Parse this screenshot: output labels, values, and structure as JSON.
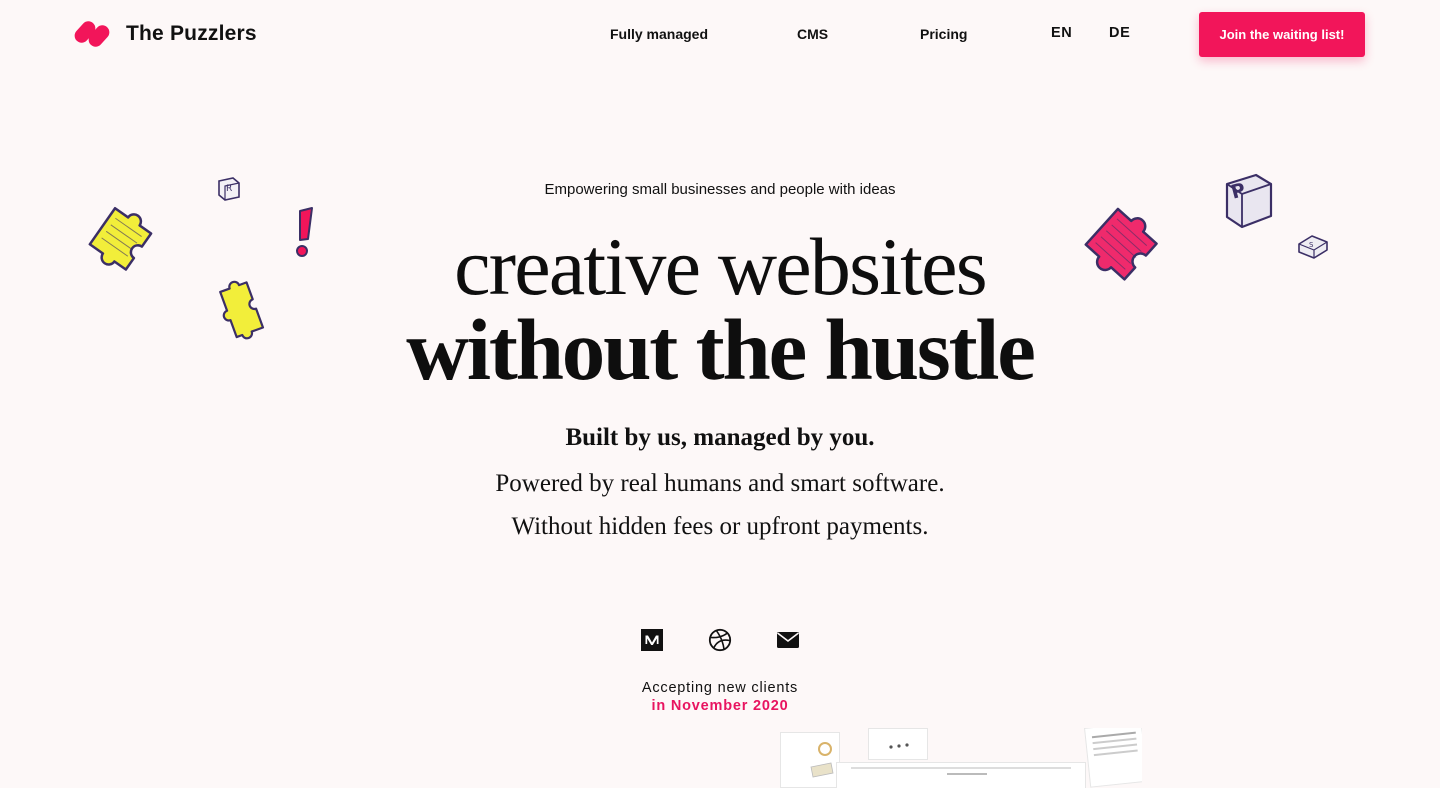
{
  "header": {
    "brand": "The Puzzlers",
    "nav": [
      {
        "label": "Fully managed"
      },
      {
        "label": "CMS"
      },
      {
        "label": "Pricing"
      }
    ],
    "languages": {
      "en": "EN",
      "de": "DE",
      "active": "EN"
    },
    "cta_label": "Join the waiting list!"
  },
  "hero": {
    "tagline": "Empowering small businesses and people with ideas",
    "headline_line1": "creative websites",
    "headline_line2": "without the hustle",
    "subhead_highlight": "Built by us, managed by you.",
    "subhead_line2": "Powered by real humans and smart software.",
    "subhead_line3": "Without hidden fees or upfront payments."
  },
  "social": {
    "icons": [
      "medium-icon",
      "dribbble-icon",
      "mail-icon"
    ]
  },
  "availability": {
    "line1": "Accepting new clients",
    "line2": "in November 2020"
  },
  "colors": {
    "brand": "#f2155a",
    "highlight": "#f7f71d",
    "background": "#fdf8f8",
    "date_accent": "#e81460"
  }
}
